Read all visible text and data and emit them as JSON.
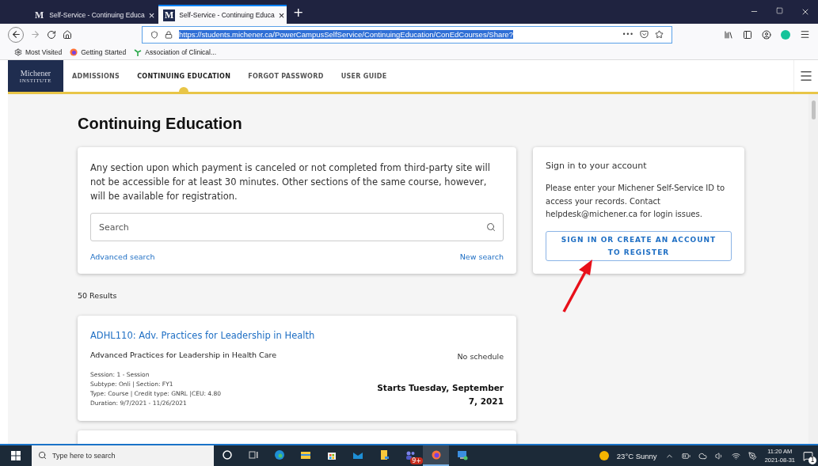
{
  "browser": {
    "tabs": [
      {
        "title": "Self-Service - Continuing Educa",
        "logo": "M",
        "close": "×",
        "selected": false
      },
      {
        "title": "Self-Service - Continuing Educa",
        "logo": "M",
        "close": "×",
        "selected": true
      }
    ],
    "new_tab": "+",
    "url": {
      "text": "https://students.michener.ca/PowerCampusSelfService/ContinuingEducation/ConEdCourses/Share?",
      "highlighted": true
    },
    "more": "•••",
    "bookmarks": [
      {
        "kind": "gear",
        "label": "Most Visited"
      },
      {
        "kind": "firefox",
        "label": "Getting Started"
      },
      {
        "kind": "leaf",
        "label": "Association of Clinical..."
      }
    ]
  },
  "site": {
    "logo": {
      "name": "Michener",
      "sub": "INSTITUTE"
    },
    "nav": [
      {
        "label": "ADMISSIONS",
        "selected": false
      },
      {
        "label": "CONTINUING EDUCATION",
        "selected": true
      },
      {
        "label": "FORGOT PASSWORD",
        "selected": false
      },
      {
        "label": "USER GUIDE",
        "selected": false
      }
    ]
  },
  "page": {
    "title": "Continuing Education",
    "notice": "Any section upon which payment is canceled or not completed from third-party site will not be accessible for at least 30 minutes. Other sections of the same course, however, will be available for registration.",
    "search": {
      "placeholder": "Search"
    },
    "advanced_search": "Advanced search",
    "new_search": "New search",
    "results": "50 Results",
    "courses": [
      {
        "title": "ADHL110: Adv. Practices for Leadership in Health",
        "name": "Advanced Practices for Leadership in Health Care",
        "details": [
          "Session: 1 - Session",
          "Subtype: Onli | Section: FY1",
          "Type: Course | Credit type: GNRL |CEU: 4.80",
          "Duration: 9/7/2021 - 11/26/2021"
        ],
        "schedule": "No schedule",
        "starts": "Starts Tuesday, September 7, 2021"
      }
    ],
    "sign_in": {
      "heading": "Sign in to your account",
      "text": "Please enter your Michener Self-Service ID to access your records. Contact helpdesk@michener.ca for login issues.",
      "button": "SIGN IN OR CREATE AN ACCOUNT TO REGISTER"
    }
  },
  "taskbar": {
    "search": {
      "placeholder": "Type here to search"
    },
    "apps": [
      {
        "kind": "cortana",
        "selected": false
      },
      {
        "kind": "taskview",
        "selected": false
      },
      {
        "kind": "edge",
        "selected": false
      },
      {
        "kind": "explorer",
        "selected": false
      },
      {
        "kind": "store",
        "selected": false
      },
      {
        "kind": "mail",
        "selected": false
      },
      {
        "kind": "sticky",
        "selected": false
      },
      {
        "kind": "teams",
        "selected": false,
        "badge": "9+"
      },
      {
        "kind": "firefox",
        "selected": true
      },
      {
        "kind": "remote",
        "selected": false
      }
    ],
    "weather": "23°C  Sunny",
    "time": "11:20 AM",
    "date": "2021-08-31",
    "notifications": "1"
  }
}
